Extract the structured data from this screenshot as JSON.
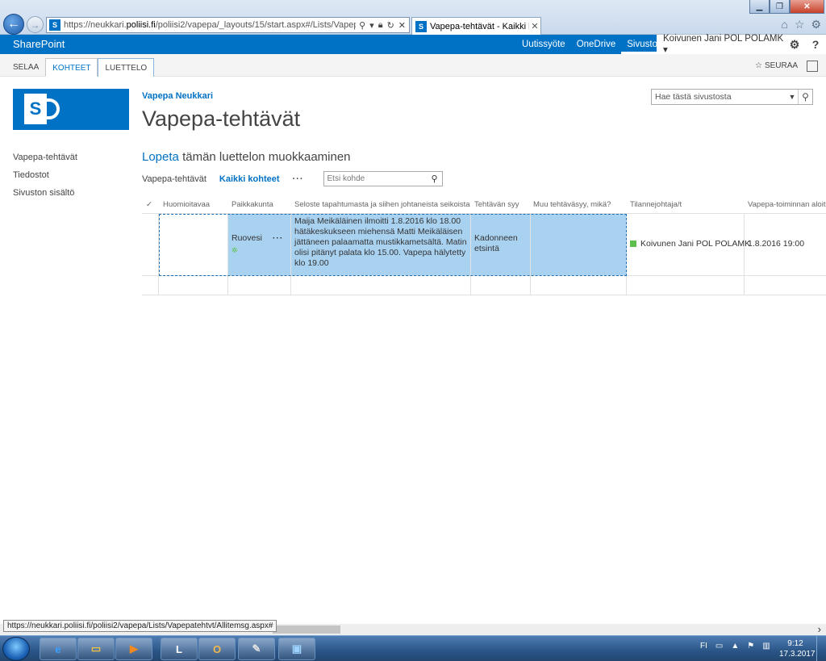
{
  "browser": {
    "url_prefix": "https://neukkari.",
    "url_domain": "poliisi.fi",
    "url_rest": "/poliisi2/vapepa/_layouts/15/start.aspx#/Lists/Vapepatehtvt/Allit",
    "tab_title": "Vapepa-tehtävät - Kaikki k..."
  },
  "suitebar": {
    "brand": "SharePoint",
    "links": [
      "Uutissyöte",
      "OneDrive",
      "Sivustot"
    ],
    "user_name": "Koivunen Jani POL POLAMK",
    "help_label": "?"
  },
  "ribbon": {
    "tabs": [
      "SELAA",
      "KOHTEET",
      "LUETTELO"
    ],
    "follow_label": "SEURAA"
  },
  "site": {
    "title": "Vapepa Neukkari",
    "page_title": "Vapepa-tehtävät",
    "search_placeholder": "Hae tästä sivustosta",
    "logo_letter": "S"
  },
  "quicklaunch": [
    "Vapepa-tehtävät",
    "Tiedostot",
    "Sivuston sisältö"
  ],
  "main": {
    "stop_link": "Lopeta",
    "stop_rest": "tämän luettelon muokkaaminen",
    "view_1": "Vapepa-tehtävät",
    "view_2": "Kaikki kohteet",
    "more": "···",
    "find_placeholder": "Etsi kohde"
  },
  "grid": {
    "columns": [
      "Huomioitavaa",
      "Paikkakunta",
      "Seloste tapahtumasta ja siihen johtaneista seikoista",
      "Tehtävän syy",
      "Muu tehtäväsyy, mikä?",
      "Tilannejohtaja/t",
      "Vapepa-toiminnan aloitu"
    ],
    "rows": [
      {
        "huomioitavaa": "",
        "paikkakunta": "Ruovesi",
        "more": "···",
        "seloste": "Maija Meikäläinen ilmoitti 1.8.2016 klo 18.00 hätäkeskukseen miehensä Matti Meikäläisen jättäneen palaamatta mustikkametsältä. Matin olisi pitänyt palata klo 15.00. Vapepa hälytetty klo 19.00",
        "syy": "Kadonneen etsintä",
        "muu": "",
        "tilannejohtaja": "Koivunen Jani POL POLAMK",
        "aloitus": "1.8.2016 19:00"
      }
    ]
  },
  "statusbar": {
    "url": "https://neukkari.poliisi.fi/poliisi2/vapepa/Lists/Vapepatehtvt/Allitemsg.aspx#"
  },
  "taskbar": {
    "lang": "FI",
    "time": "9:12",
    "date": "17.3.2017"
  }
}
